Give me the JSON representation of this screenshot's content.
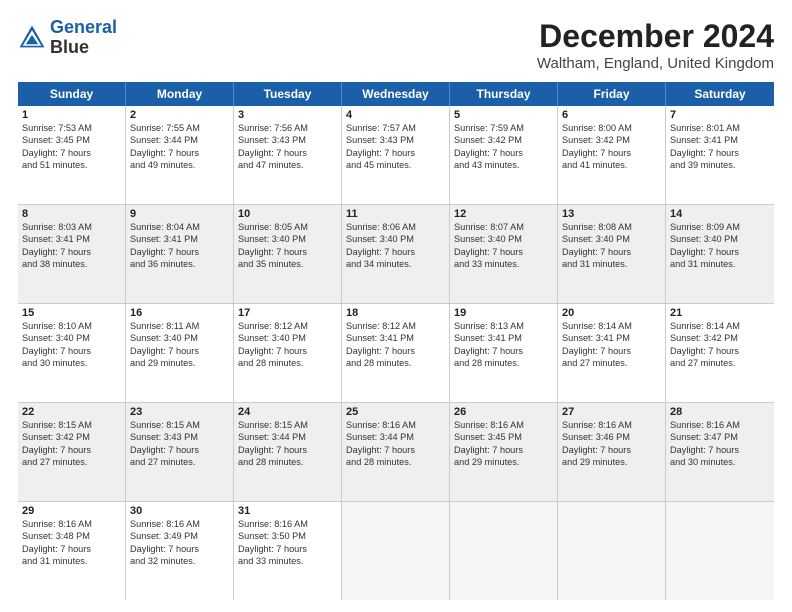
{
  "logo": {
    "line1": "General",
    "line2": "Blue"
  },
  "title": "December 2024",
  "subtitle": "Waltham, England, United Kingdom",
  "days": [
    "Sunday",
    "Monday",
    "Tuesday",
    "Wednesday",
    "Thursday",
    "Friday",
    "Saturday"
  ],
  "rows": [
    [
      {
        "day": "1",
        "lines": [
          "Sunrise: 7:53 AM",
          "Sunset: 3:45 PM",
          "Daylight: 7 hours",
          "and 51 minutes."
        ]
      },
      {
        "day": "2",
        "lines": [
          "Sunrise: 7:55 AM",
          "Sunset: 3:44 PM",
          "Daylight: 7 hours",
          "and 49 minutes."
        ]
      },
      {
        "day": "3",
        "lines": [
          "Sunrise: 7:56 AM",
          "Sunset: 3:43 PM",
          "Daylight: 7 hours",
          "and 47 minutes."
        ]
      },
      {
        "day": "4",
        "lines": [
          "Sunrise: 7:57 AM",
          "Sunset: 3:43 PM",
          "Daylight: 7 hours",
          "and 45 minutes."
        ]
      },
      {
        "day": "5",
        "lines": [
          "Sunrise: 7:59 AM",
          "Sunset: 3:42 PM",
          "Daylight: 7 hours",
          "and 43 minutes."
        ]
      },
      {
        "day": "6",
        "lines": [
          "Sunrise: 8:00 AM",
          "Sunset: 3:42 PM",
          "Daylight: 7 hours",
          "and 41 minutes."
        ]
      },
      {
        "day": "7",
        "lines": [
          "Sunrise: 8:01 AM",
          "Sunset: 3:41 PM",
          "Daylight: 7 hours",
          "and 39 minutes."
        ]
      }
    ],
    [
      {
        "day": "8",
        "lines": [
          "Sunrise: 8:03 AM",
          "Sunset: 3:41 PM",
          "Daylight: 7 hours",
          "and 38 minutes."
        ]
      },
      {
        "day": "9",
        "lines": [
          "Sunrise: 8:04 AM",
          "Sunset: 3:41 PM",
          "Daylight: 7 hours",
          "and 36 minutes."
        ]
      },
      {
        "day": "10",
        "lines": [
          "Sunrise: 8:05 AM",
          "Sunset: 3:40 PM",
          "Daylight: 7 hours",
          "and 35 minutes."
        ]
      },
      {
        "day": "11",
        "lines": [
          "Sunrise: 8:06 AM",
          "Sunset: 3:40 PM",
          "Daylight: 7 hours",
          "and 34 minutes."
        ]
      },
      {
        "day": "12",
        "lines": [
          "Sunrise: 8:07 AM",
          "Sunset: 3:40 PM",
          "Daylight: 7 hours",
          "and 33 minutes."
        ]
      },
      {
        "day": "13",
        "lines": [
          "Sunrise: 8:08 AM",
          "Sunset: 3:40 PM",
          "Daylight: 7 hours",
          "and 31 minutes."
        ]
      },
      {
        "day": "14",
        "lines": [
          "Sunrise: 8:09 AM",
          "Sunset: 3:40 PM",
          "Daylight: 7 hours",
          "and 31 minutes."
        ]
      }
    ],
    [
      {
        "day": "15",
        "lines": [
          "Sunrise: 8:10 AM",
          "Sunset: 3:40 PM",
          "Daylight: 7 hours",
          "and 30 minutes."
        ]
      },
      {
        "day": "16",
        "lines": [
          "Sunrise: 8:11 AM",
          "Sunset: 3:40 PM",
          "Daylight: 7 hours",
          "and 29 minutes."
        ]
      },
      {
        "day": "17",
        "lines": [
          "Sunrise: 8:12 AM",
          "Sunset: 3:40 PM",
          "Daylight: 7 hours",
          "and 28 minutes."
        ]
      },
      {
        "day": "18",
        "lines": [
          "Sunrise: 8:12 AM",
          "Sunset: 3:41 PM",
          "Daylight: 7 hours",
          "and 28 minutes."
        ]
      },
      {
        "day": "19",
        "lines": [
          "Sunrise: 8:13 AM",
          "Sunset: 3:41 PM",
          "Daylight: 7 hours",
          "and 28 minutes."
        ]
      },
      {
        "day": "20",
        "lines": [
          "Sunrise: 8:14 AM",
          "Sunset: 3:41 PM",
          "Daylight: 7 hours",
          "and 27 minutes."
        ]
      },
      {
        "day": "21",
        "lines": [
          "Sunrise: 8:14 AM",
          "Sunset: 3:42 PM",
          "Daylight: 7 hours",
          "and 27 minutes."
        ]
      }
    ],
    [
      {
        "day": "22",
        "lines": [
          "Sunrise: 8:15 AM",
          "Sunset: 3:42 PM",
          "Daylight: 7 hours",
          "and 27 minutes."
        ]
      },
      {
        "day": "23",
        "lines": [
          "Sunrise: 8:15 AM",
          "Sunset: 3:43 PM",
          "Daylight: 7 hours",
          "and 27 minutes."
        ]
      },
      {
        "day": "24",
        "lines": [
          "Sunrise: 8:15 AM",
          "Sunset: 3:44 PM",
          "Daylight: 7 hours",
          "and 28 minutes."
        ]
      },
      {
        "day": "25",
        "lines": [
          "Sunrise: 8:16 AM",
          "Sunset: 3:44 PM",
          "Daylight: 7 hours",
          "and 28 minutes."
        ]
      },
      {
        "day": "26",
        "lines": [
          "Sunrise: 8:16 AM",
          "Sunset: 3:45 PM",
          "Daylight: 7 hours",
          "and 29 minutes."
        ]
      },
      {
        "day": "27",
        "lines": [
          "Sunrise: 8:16 AM",
          "Sunset: 3:46 PM",
          "Daylight: 7 hours",
          "and 29 minutes."
        ]
      },
      {
        "day": "28",
        "lines": [
          "Sunrise: 8:16 AM",
          "Sunset: 3:47 PM",
          "Daylight: 7 hours",
          "and 30 minutes."
        ]
      }
    ],
    [
      {
        "day": "29",
        "lines": [
          "Sunrise: 8:16 AM",
          "Sunset: 3:48 PM",
          "Daylight: 7 hours",
          "and 31 minutes."
        ]
      },
      {
        "day": "30",
        "lines": [
          "Sunrise: 8:16 AM",
          "Sunset: 3:49 PM",
          "Daylight: 7 hours",
          "and 32 minutes."
        ]
      },
      {
        "day": "31",
        "lines": [
          "Sunrise: 8:16 AM",
          "Sunset: 3:50 PM",
          "Daylight: 7 hours",
          "and 33 minutes."
        ]
      },
      {
        "day": "",
        "lines": []
      },
      {
        "day": "",
        "lines": []
      },
      {
        "day": "",
        "lines": []
      },
      {
        "day": "",
        "lines": []
      }
    ]
  ]
}
